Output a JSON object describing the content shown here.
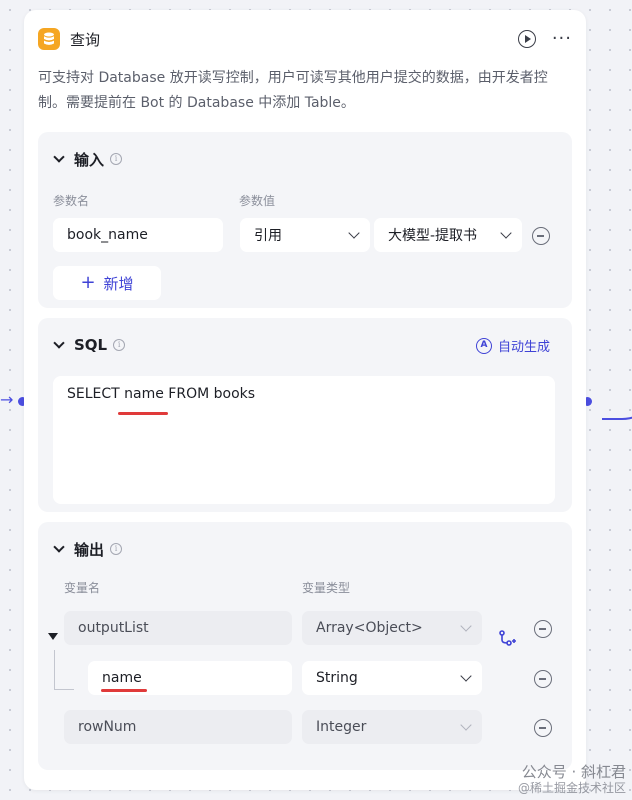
{
  "node": {
    "title": "查询",
    "description": "可支持对 Database 放开读写控制，用户可读写其他用户提交的数据，由开发者控制。需要提前在 Bot 的 Database 中添加 Table。"
  },
  "input_section": {
    "title": "输入",
    "param_name_label": "参数名",
    "param_value_label": "参数值",
    "params": [
      {
        "name": "book_name",
        "value_type": "引用",
        "value_ref": "大模型-提取书"
      }
    ],
    "add_label": "新增"
  },
  "sql_section": {
    "title": "SQL",
    "auto_generate_label": "自动生成",
    "query": "SELECT name FROM books"
  },
  "output_section": {
    "title": "输出",
    "var_name_label": "变量名",
    "var_type_label": "变量类型",
    "vars": [
      {
        "name": "outputList",
        "type": "Array<Object>"
      },
      {
        "name": "name",
        "type": "String"
      },
      {
        "name": "rowNum",
        "type": "Integer"
      }
    ]
  },
  "watermark": {
    "line1": "公众号 · 斜杠君",
    "line2": "@稀土掘金技术社区"
  },
  "colors": {
    "accent": "#3f43d6",
    "db_icon": "#f5a623",
    "highlight": "#e03a3a"
  }
}
